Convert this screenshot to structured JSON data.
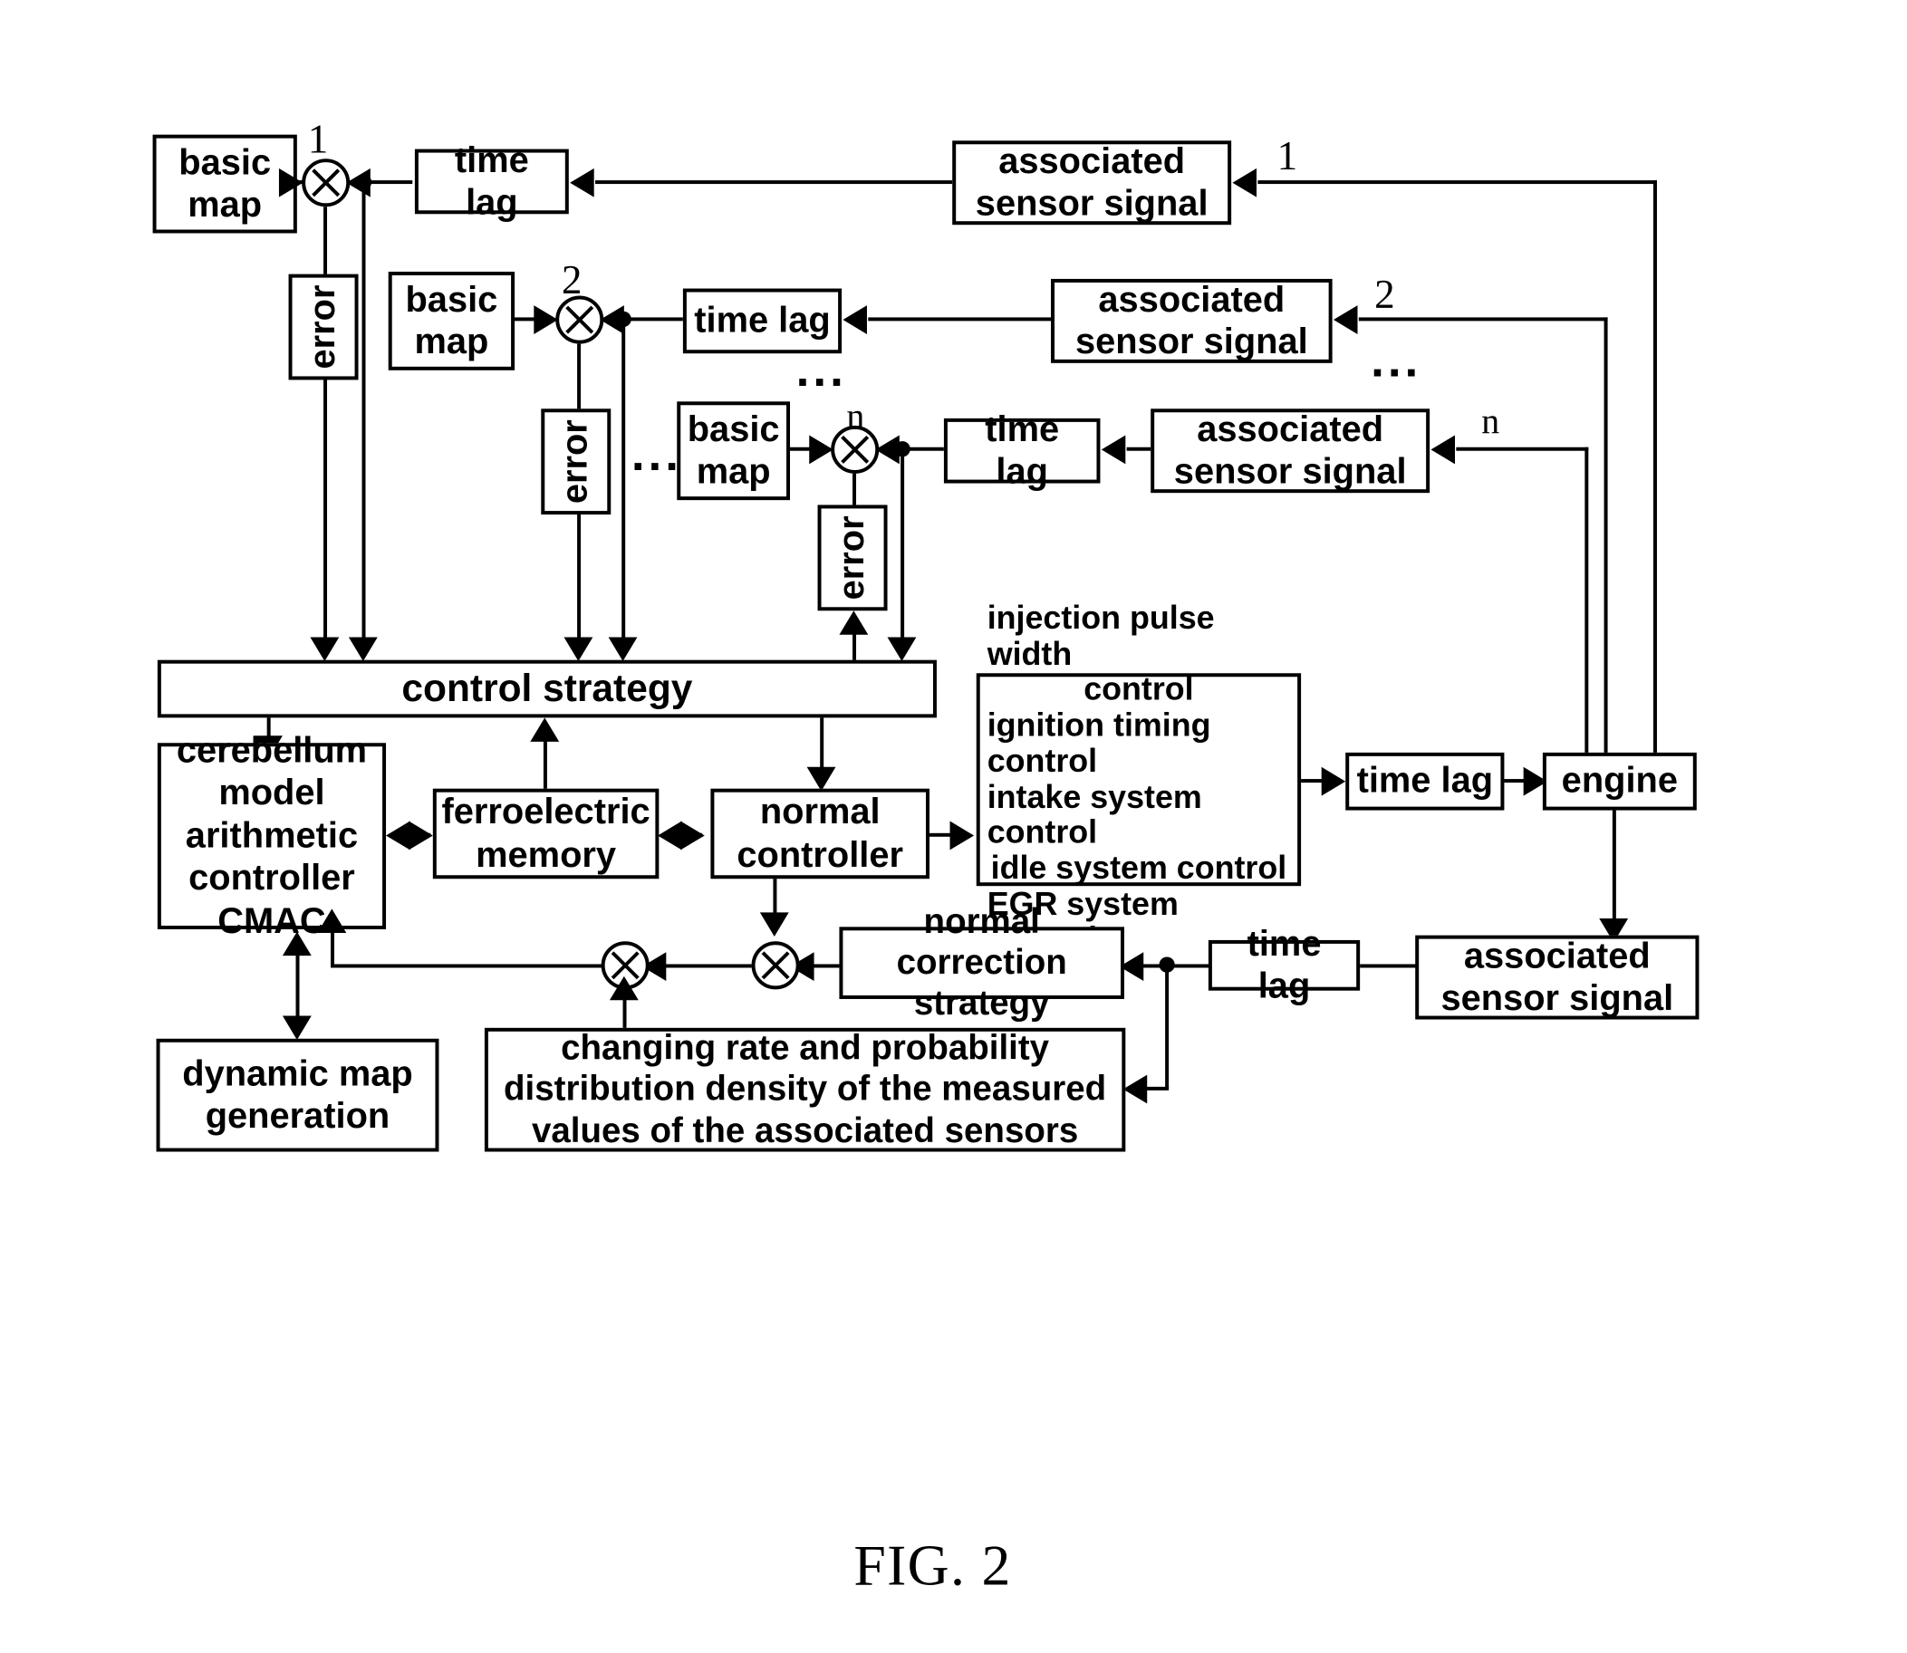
{
  "figure": {
    "caption": "FIG. 2",
    "ellipsis": "..."
  },
  "channels": {
    "indices": [
      "1",
      "2",
      "n"
    ],
    "basic_map_label": "basic map",
    "time_lag_label": "time lag",
    "sensor_label": "associated sensor signal",
    "error_label": "error"
  },
  "blocks": {
    "basic_map_1": "basic map",
    "basic_map_2": "basic map",
    "basic_map_n": "basic map",
    "time_lag_1": "time lag",
    "time_lag_2": "time lag",
    "time_lag_n": "time lag",
    "sensor_1": "associated sensor signal",
    "sensor_2": "associated sensor signal",
    "sensor_n": "associated sensor signal",
    "error_1": "error",
    "error_2": "error",
    "error_n": "error",
    "control_strategy": "control strategy",
    "cmac": "cerebellum model arithmetic controller CMAC",
    "ferroelectric_memory": "ferroelectric memory",
    "normal_controller": "normal controller",
    "actuator_controls": "injection pulse width control\nignition timing control\nintake system control\nidle system control\nEGR system control",
    "time_lag_actuator": "time lag",
    "engine": "engine",
    "normal_correction_strategy": "normal correction strategy",
    "time_lag_feedback": "time lag",
    "sensor_feedback": "associated sensor signal",
    "changing_rate": "changing rate and probability distribution density of the measured values of the associated sensors",
    "dynamic_map_generation": "dynamic map generation"
  },
  "actuator_lines": [
    "injection pulse width",
    "control",
    "ignition timing control",
    "intake system control",
    "idle system control",
    "EGR system control"
  ],
  "cmac_lines": [
    "cerebellum",
    "model",
    "arithmetic",
    "controller",
    "CMAC"
  ],
  "changing_rate_lines": [
    "changing rate and probability",
    "distribution density of the measured",
    "values of the associated sensors"
  ],
  "colors": {
    "stroke": "#000000",
    "background": "#ffffff"
  }
}
